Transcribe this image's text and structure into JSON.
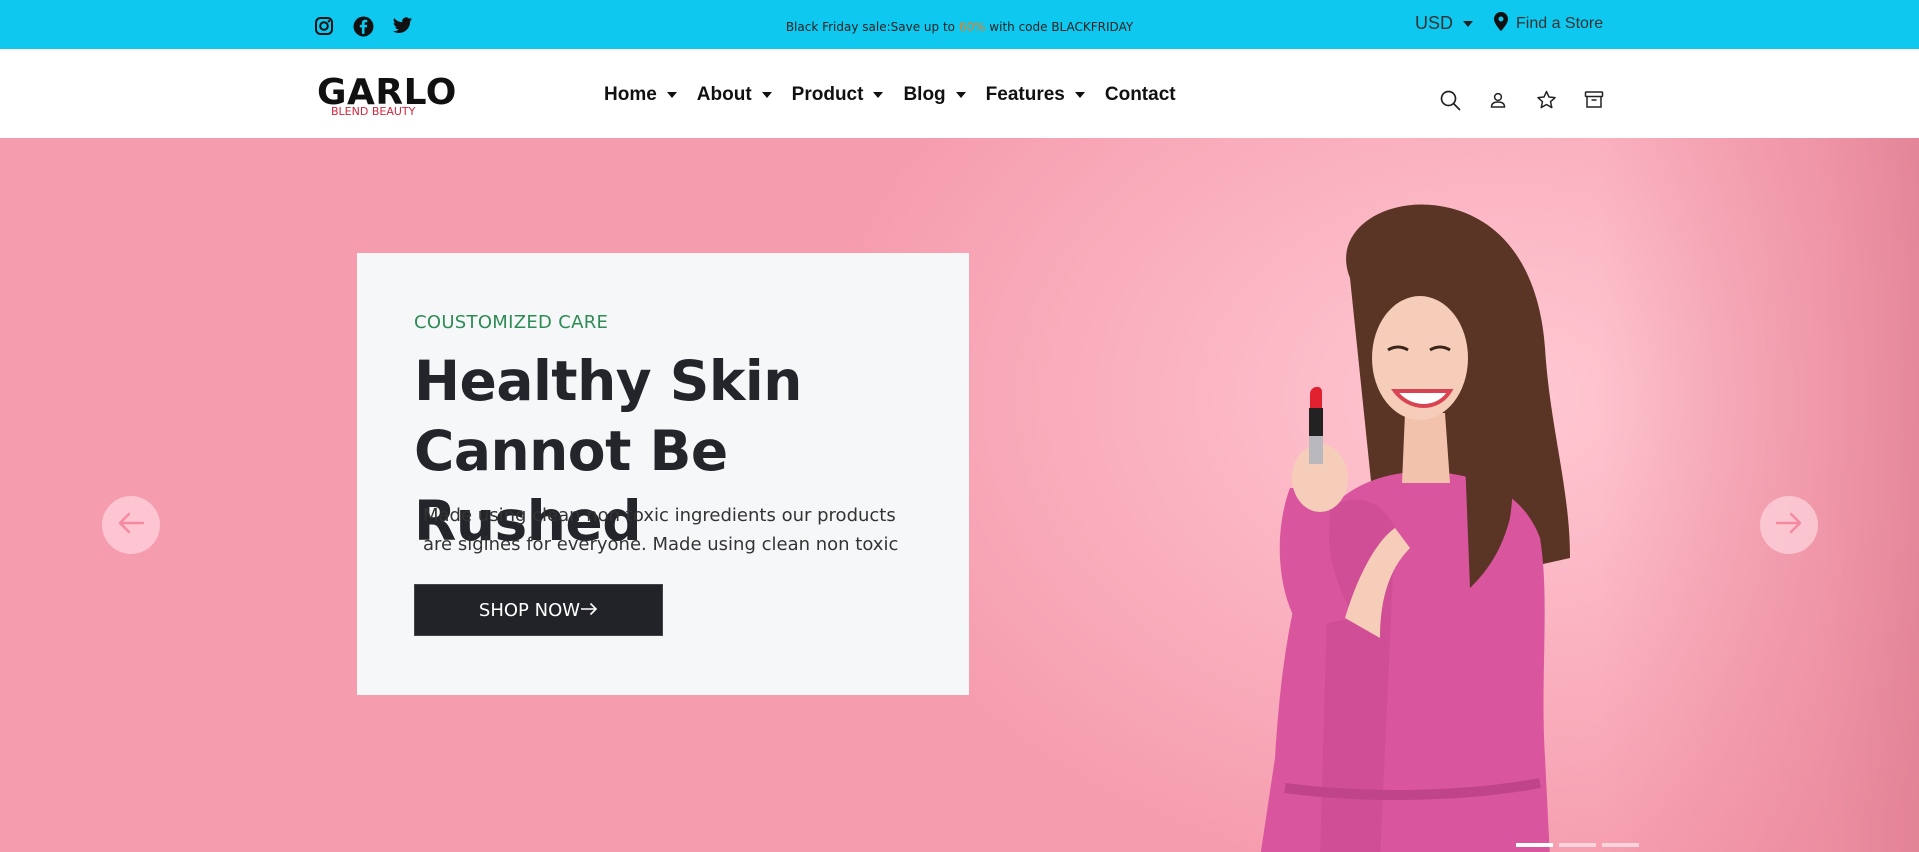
{
  "topbar": {
    "social_icons": [
      "instagram-icon",
      "facebook-icon",
      "twitter-icon"
    ],
    "promo_prefix": "Black Friday sale:Save up to ",
    "promo_highlight": "60%",
    "promo_suffix": " with code BLACKFRIDAY",
    "currency": "USD",
    "find_store": "Find a Store",
    "background_color": "#0ec8f0",
    "highlight_color": "#f07a1a"
  },
  "header": {
    "logo_text": "GARLO",
    "logo_subtext": "BLEND BEAUTY",
    "nav": [
      {
        "label": "Home",
        "has_dropdown": true
      },
      {
        "label": "About",
        "has_dropdown": true
      },
      {
        "label": "Product",
        "has_dropdown": true
      },
      {
        "label": "Blog",
        "has_dropdown": true
      },
      {
        "label": "Features",
        "has_dropdown": true
      },
      {
        "label": "Contact",
        "has_dropdown": false
      }
    ],
    "icons": [
      "search-icon",
      "user-icon",
      "star-icon",
      "archive-icon"
    ]
  },
  "hero": {
    "eyebrow": "COUSTOMIZED CARE",
    "headline": "Healthy Skin Cannot Be Rushed",
    "description": "Made using clean non toxic ingredients our products are sigines for everyone. Made using clean non toxic",
    "cta_label": "SHOP NOW",
    "accent_color": "#2f8b55",
    "slides": 3,
    "active_slide": 1
  }
}
